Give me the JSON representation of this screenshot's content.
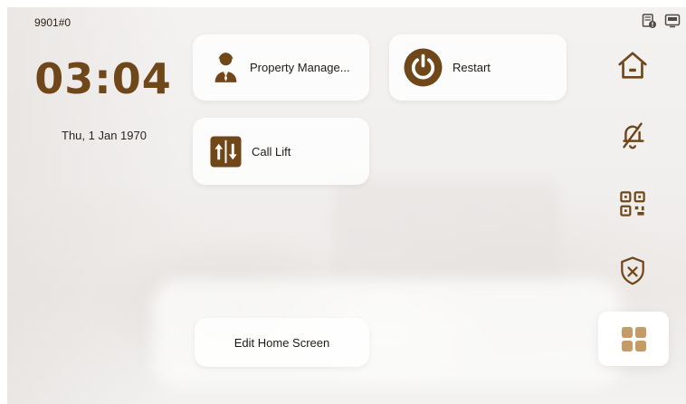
{
  "status_bar": {
    "device_id": "9901#0",
    "icons": [
      "storage-status-icon",
      "display-status-icon"
    ]
  },
  "clock": {
    "time": "03:04",
    "date": "Thu, 1 Jan 1970"
  },
  "tiles": {
    "property_management": {
      "label": "Property Manage...",
      "icon": "person-icon"
    },
    "restart": {
      "label": "Restart",
      "icon": "power-icon"
    },
    "call_lift": {
      "label": "Call Lift",
      "icon": "elevator-icon"
    },
    "edit_home": {
      "label": "Edit Home Screen"
    }
  },
  "side_nav": [
    {
      "name": "home",
      "icon": "home-icon"
    },
    {
      "name": "do-not-disturb",
      "icon": "bell-off-icon"
    },
    {
      "name": "qr-code",
      "icon": "qr-code-icon"
    },
    {
      "name": "security",
      "icon": "shield-x-icon"
    },
    {
      "name": "apps",
      "icon": "grid-icon",
      "selected": true
    }
  ],
  "colors": {
    "accent": "#704719",
    "app_grid": "#c49b67",
    "text_dark": "#1f1a17"
  }
}
